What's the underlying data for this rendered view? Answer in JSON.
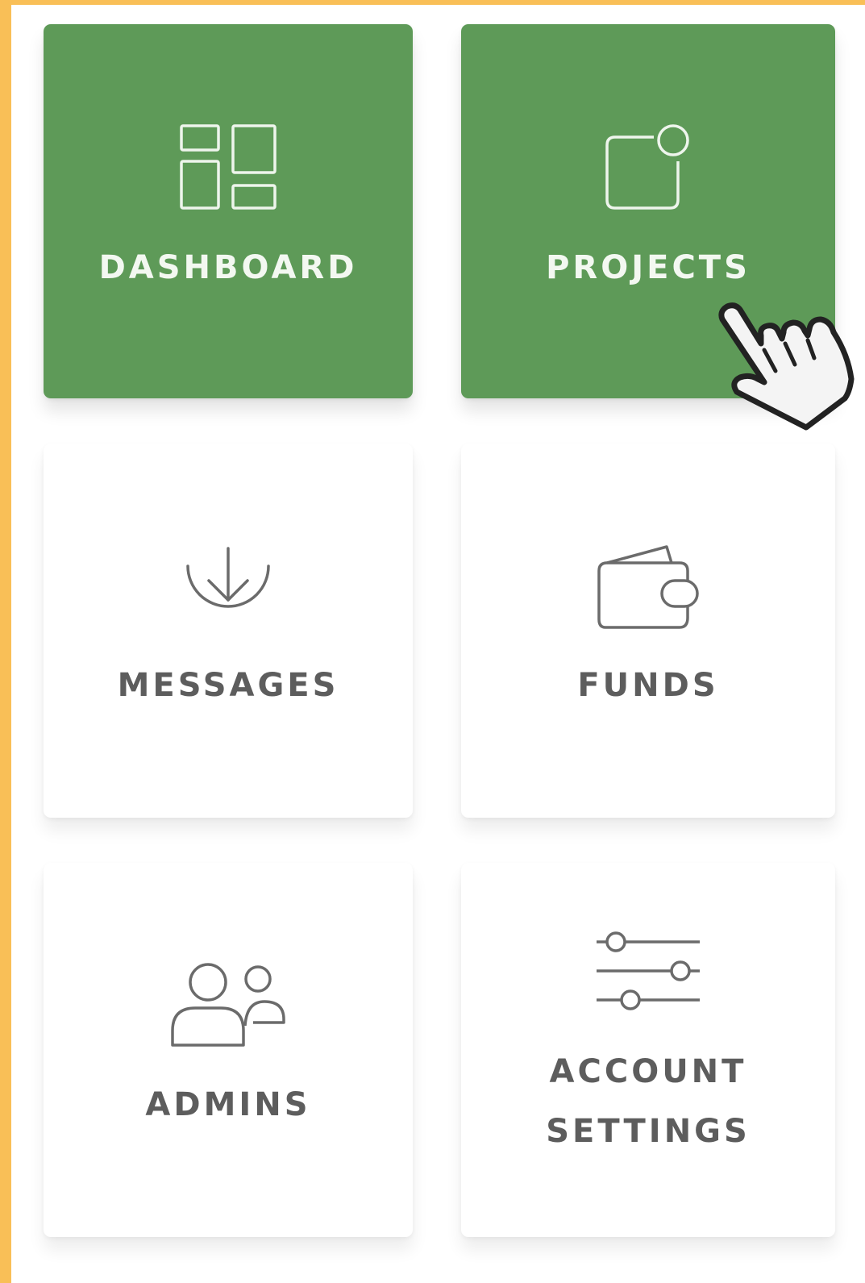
{
  "theme": {
    "frame_color": "#f9bf57",
    "accent_color": "#5e9a58",
    "icon_color_inactive": "#6b6b6b",
    "icon_color_active": "#eef5ec"
  },
  "menu": {
    "items": [
      {
        "label": "DASHBOARD",
        "icon": "dashboard-icon",
        "active": true
      },
      {
        "label": "PROJECTS",
        "icon": "project-icon",
        "active": true
      },
      {
        "label": "MESSAGES",
        "icon": "download-icon",
        "active": false
      },
      {
        "label": "FUNDS",
        "icon": "wallet-icon",
        "active": false
      },
      {
        "label": "ADMINS",
        "icon": "users-icon",
        "active": false
      },
      {
        "label": "ACCOUNT SETTINGS",
        "icon": "sliders-icon",
        "active": false
      }
    ]
  },
  "cursor": {
    "icon": "hand-pointer-icon"
  }
}
